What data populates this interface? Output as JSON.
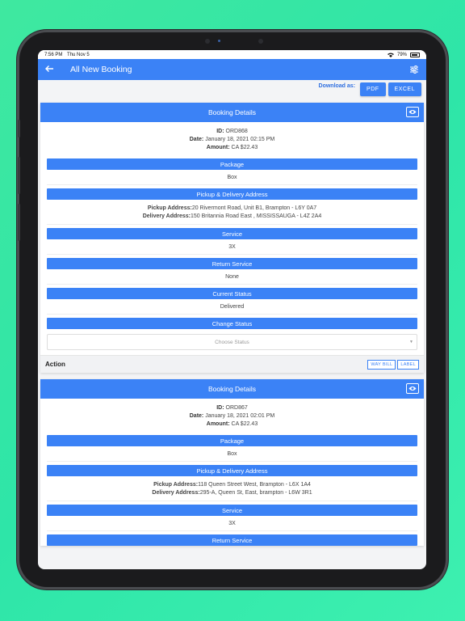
{
  "status_bar": {
    "time": "7:56 PM",
    "date": "Thu Nov 5",
    "battery": "79%"
  },
  "nav": {
    "title": "All New Booking"
  },
  "download": {
    "label": "Download as:",
    "pdf": "PDF",
    "excel": "EXCEL"
  },
  "bookings": [
    {
      "header": "Booking Details",
      "id_label": "ID:",
      "id": "ORD868",
      "date_label": "Date:",
      "date": "January 18, 2021 02:15 PM",
      "amount_label": "Amount:",
      "amount": "CA $22.43",
      "package_label": "Package",
      "package": "Box",
      "address_label": "Pickup & Delivery Address",
      "pickup_label": "Pickup Address:",
      "pickup": "20 Rivermont Road, Unit B1, Brampton - L6Y 0A7",
      "delivery_label": "Delivery Address:",
      "delivery": "150 Britannia Road East , MISSISSAUGA - L4Z 2A4",
      "service_label": "Service",
      "service": "3X",
      "return_label": "Return Service",
      "return": "None",
      "status_label": "Current Status",
      "status": "Delivered",
      "change_label": "Change Status",
      "change_placeholder": "Choose Status",
      "action_label": "Action",
      "waybill": "WAY BILL",
      "label_btn": "LABEL"
    },
    {
      "header": "Booking Details",
      "id_label": "ID:",
      "id": "ORD867",
      "date_label": "Date:",
      "date": "January 18, 2021 02:01 PM",
      "amount_label": "Amount:",
      "amount": "CA $22.43",
      "package_label": "Package",
      "package": "Box",
      "address_label": "Pickup & Delivery Address",
      "pickup_label": "Pickup Address:",
      "pickup": "118 Queen Street West, Brampton - L6X 1A4",
      "delivery_label": "Delivery Address:",
      "delivery": "295-A, Queen St, East, brampton - L6W 3R1",
      "service_label": "Service",
      "service": "3X",
      "return_label": "Return Service"
    }
  ]
}
